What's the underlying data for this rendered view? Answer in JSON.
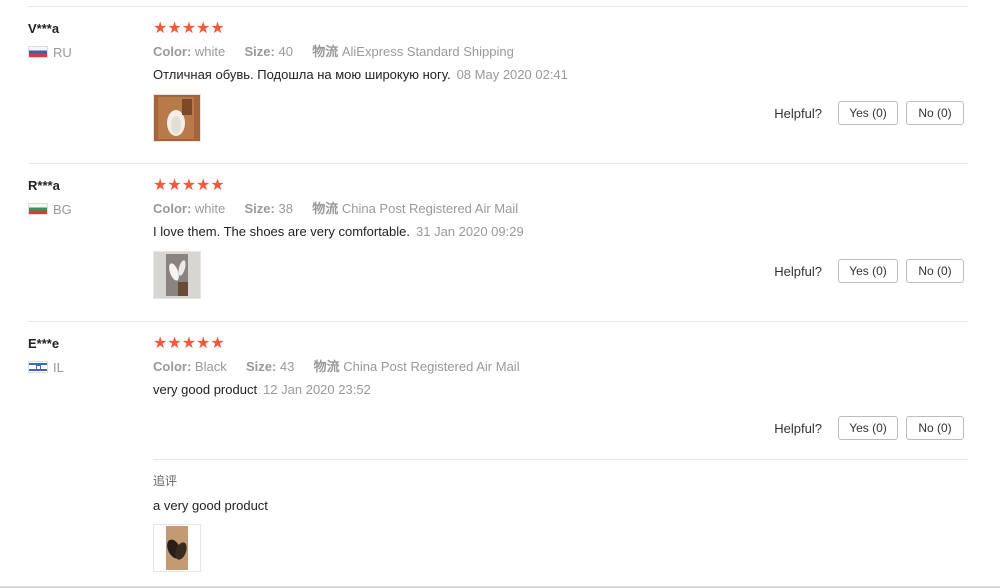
{
  "reviews": [
    {
      "name": "V***a",
      "country": "RU",
      "stars": "★★★★★",
      "color_label": "Color:",
      "color": "white",
      "size_label": "Size:",
      "size": "40",
      "shipping_label": "物流",
      "shipping": "AliExpress Standard Shipping",
      "text": "Отличная обувь. Подошла на мою широкую ногу.",
      "date": "08 May 2020 02:41",
      "helpful_label": "Helpful?",
      "yes_label": "Yes (0)",
      "no_label": "No (0)"
    },
    {
      "name": "R***a",
      "country": "BG",
      "stars": "★★★★★",
      "color_label": "Color:",
      "color": "white",
      "size_label": "Size:",
      "size": "38",
      "shipping_label": "物流",
      "shipping": "China Post Registered Air Mail",
      "text": "I love them. The shoes are very comfortable.",
      "date": "31 Jan 2020 09:29",
      "helpful_label": "Helpful?",
      "yes_label": "Yes (0)",
      "no_label": "No (0)"
    },
    {
      "name": "E***e",
      "country": "IL",
      "stars": "★★★★★",
      "color_label": "Color:",
      "color": "Black",
      "size_label": "Size:",
      "size": "43",
      "shipping_label": "物流",
      "shipping": "China Post Registered Air Mail",
      "text": "very good product",
      "date": "12 Jan 2020 23:52",
      "helpful_label": "Helpful?",
      "yes_label": "Yes (0)",
      "no_label": "No (0)",
      "followup_label": "追评",
      "followup_text": "a very good product"
    }
  ],
  "colors": {
    "star": "#f05a3c",
    "muted": "#999999",
    "separator": "#e8e8e8"
  }
}
